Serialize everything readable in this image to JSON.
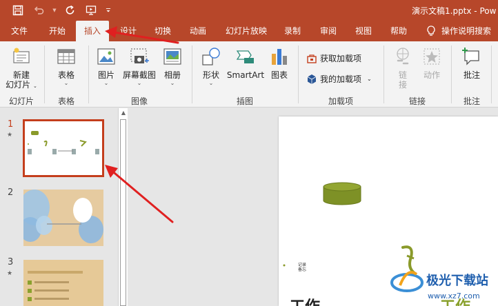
{
  "app": {
    "document_title": "演示文稿1.pptx - Pow"
  },
  "quick_access": {
    "icons": [
      "save-icon",
      "undo-icon",
      "redo-icon",
      "start-from-beginning-icon",
      "customize-icon"
    ]
  },
  "tabs": [
    {
      "label": "文件"
    },
    {
      "label": "开始"
    },
    {
      "label": "插入",
      "active": true
    },
    {
      "label": "设计"
    },
    {
      "label": "切换"
    },
    {
      "label": "动画"
    },
    {
      "label": "幻灯片放映"
    },
    {
      "label": "录制"
    },
    {
      "label": "审阅"
    },
    {
      "label": "视图"
    },
    {
      "label": "帮助"
    },
    {
      "label": "操作说明搜索"
    }
  ],
  "ribbon": {
    "new_slide": {
      "line1": "新建",
      "line2": "幻灯片"
    },
    "table": "表格",
    "picture": "图片",
    "screenshot": "屏幕截图",
    "album": "相册",
    "shapes": "形状",
    "smartart": "SmartArt",
    "chart": "图表",
    "get_addins": "获取加载项",
    "my_addins": "我的加载项",
    "link": {
      "line1": "链",
      "line2": "接"
    },
    "action": "动作",
    "comment": "批注",
    "groups": {
      "slides": "幻灯片",
      "tables": "表格",
      "images": "图像",
      "illustrations": "插图",
      "addins": "加载项",
      "links": "链接",
      "comments": "批注"
    }
  },
  "thumbnails": [
    {
      "number": "1",
      "selected": true
    },
    {
      "number": "2",
      "selected": false
    },
    {
      "number": "3",
      "selected": false
    }
  ],
  "slide": {
    "text_left": "工作",
    "text_right": "工作",
    "small_label": "记录\n备忘"
  },
  "watermark": {
    "name": "极光下载站",
    "url": "www.xz7.com"
  },
  "colors": {
    "accent": "#b7472a",
    "ribbon_bg": "#f3f3f3",
    "selection": "#c43e1c",
    "arrow": "#e02020",
    "shape_green": "#8a9a2a"
  }
}
